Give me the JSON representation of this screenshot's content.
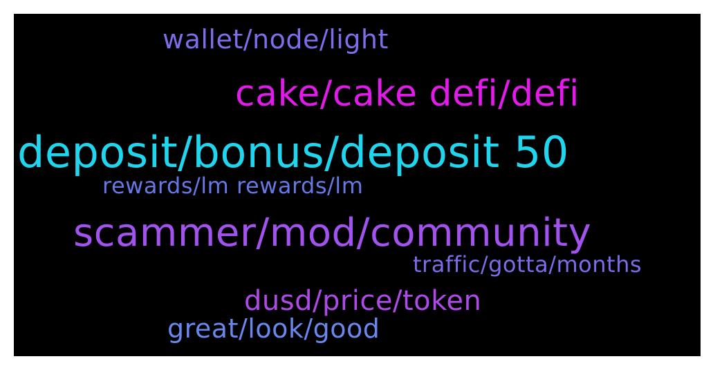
{
  "wordcloud": {
    "background": "#000000",
    "words": [
      {
        "text": "wallet/node/light",
        "color": "#7b6ee8"
      },
      {
        "text": "cake/cake defi/defi",
        "color": "#e21bea"
      },
      {
        "text": "deposit/bonus/deposit 50",
        "color": "#1fd6ee"
      },
      {
        "text": "rewards/lm rewards/lm",
        "color": "#6578e4"
      },
      {
        "text": "scammer/mod/community",
        "color": "#a252ee"
      },
      {
        "text": "traffic/gotta/months",
        "color": "#7f6ae8"
      },
      {
        "text": "dusd/price/token",
        "color": "#ad4ae8"
      },
      {
        "text": "great/look/good",
        "color": "#6987ec"
      }
    ]
  }
}
